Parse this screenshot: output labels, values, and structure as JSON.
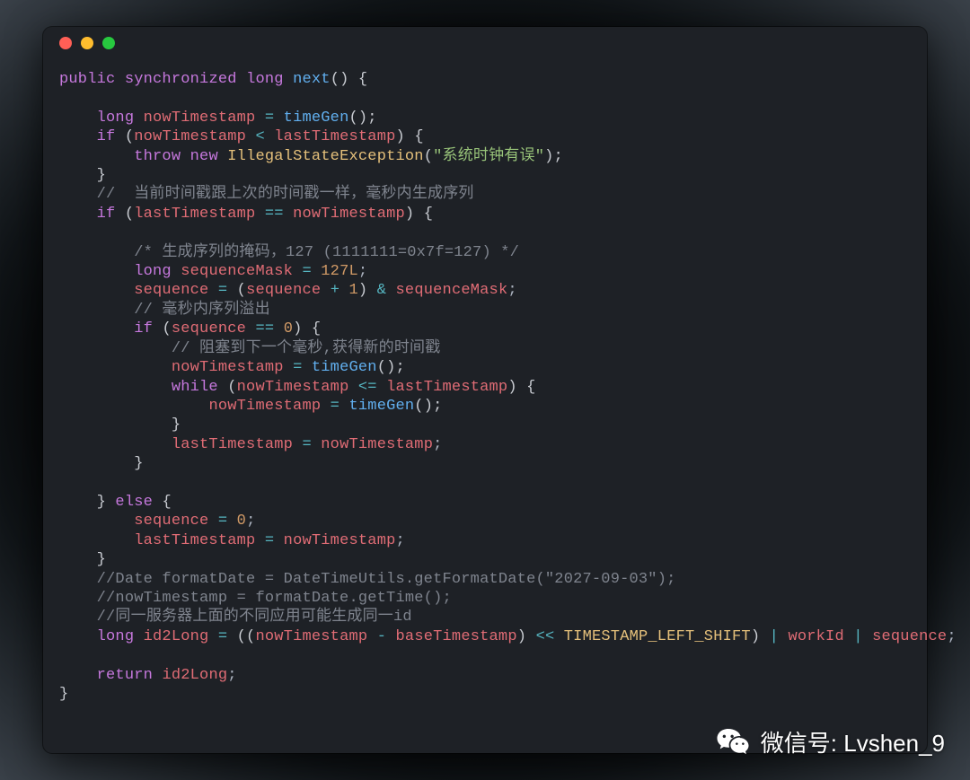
{
  "traffic": {
    "red": "#ff5f56",
    "yellow": "#ffbd2e",
    "green": "#27c93f"
  },
  "tokens": {
    "l1_public": "public",
    "l1_sync": "synchronized",
    "l1_long": "long",
    "l1_next": "next",
    "l1_rest": "() {",
    "l3_long": "long",
    "l3_nowTs": "nowTimestamp",
    "l3_eq": "=",
    "l3_timeGen": "timeGen",
    "l3_rest": "();",
    "l4_if": "if",
    "l4_lp": "(",
    "l4_nowTs": "nowTimestamp",
    "l4_lt": "<",
    "l4_lastTs": "lastTimestamp",
    "l4_rest": ") {",
    "l5_throw": "throw",
    "l5_new": "new",
    "l5_cls": "IllegalStateException",
    "l5_lp": "(",
    "l5_str": "\"系统时钟有误\"",
    "l5_rp": ");",
    "l6_cb": "}",
    "l7_cmt": "//  当前时间戳跟上次的时间戳一样，毫秒内生成序列",
    "l8_if": "if",
    "l8_lp": "(",
    "l8_lastTs": "lastTimestamp",
    "l8_eq": "==",
    "l8_nowTs": "nowTimestamp",
    "l8_rest": ") {",
    "l10_cmt": "/* 生成序列的掩码，127 (1111111=0x7f=127) */",
    "l11_long": "long",
    "l11_seqMask": "sequenceMask",
    "l11_eq": "=",
    "l11_num": "127L",
    "l11_sc": ";",
    "l12_seq": "sequence",
    "l12_eq1": "=",
    "l12_lp": "(",
    "l12_seq2": "sequence",
    "l12_plus": "+",
    "l12_one": "1",
    "l12_rp": ")",
    "l12_amp": "&",
    "l12_seqMask": "sequenceMask",
    "l12_sc": ";",
    "l13_cmt": "// 毫秒内序列溢出",
    "l14_if": "if",
    "l14_lp": "(",
    "l14_seq": "sequence",
    "l14_eq": "==",
    "l14_zero": "0",
    "l14_rest": ") {",
    "l15_cmt": "// 阻塞到下一个毫秒,获得新的时间戳",
    "l16_nowTs": "nowTimestamp",
    "l16_eq": "=",
    "l16_timeGen": "timeGen",
    "l16_rest": "();",
    "l17_while": "while",
    "l17_lp": "(",
    "l17_nowTs": "nowTimestamp",
    "l17_le": "<=",
    "l17_lastTs": "lastTimestamp",
    "l17_rest": ") {",
    "l18_nowTs": "nowTimestamp",
    "l18_eq": "=",
    "l18_timeGen": "timeGen",
    "l18_rest": "();",
    "l19_cb": "}",
    "l20_lastTs": "lastTimestamp",
    "l20_eq": "=",
    "l20_nowTs": "nowTimestamp",
    "l20_sc": ";",
    "l21_cb": "}",
    "l23_cb": "}",
    "l23_else": "else",
    "l23_ob": "{",
    "l24_seq": "sequence",
    "l24_eq": "=",
    "l24_zero": "0",
    "l24_sc": ";",
    "l25_lastTs": "lastTimestamp",
    "l25_eq": "=",
    "l25_nowTs": "nowTimestamp",
    "l25_sc": ";",
    "l26_cb": "}",
    "l27_cmt": "//Date formatDate = DateTimeUtils.getFormatDate(\"2027-09-03\");",
    "l28_cmt": "//nowTimestamp = formatDate.getTime();",
    "l29_cmt": "//同一服务器上面的不同应用可能生成同一id",
    "l30_long": "long",
    "l30_id2Long": "id2Long",
    "l30_eq": "=",
    "l30_lp": "((",
    "l30_nowTs": "nowTimestamp",
    "l30_minus": "-",
    "l30_baseTs": "baseTimestamp",
    "l30_rp": ")",
    "l30_shl": "<<",
    "l30_const": "TIMESTAMP_LEFT_SHIFT",
    "l30_rp2": ")",
    "l30_bar1": "|",
    "l30_workId": "workId",
    "l30_bar2": "|",
    "l30_seq": "sequence",
    "l30_sc": ";",
    "l32_return": "return",
    "l32_id2Long": "id2Long",
    "l32_sc": ";",
    "l33_cb": "}"
  },
  "wechat": {
    "label": "微信号: Lvshen_9"
  }
}
